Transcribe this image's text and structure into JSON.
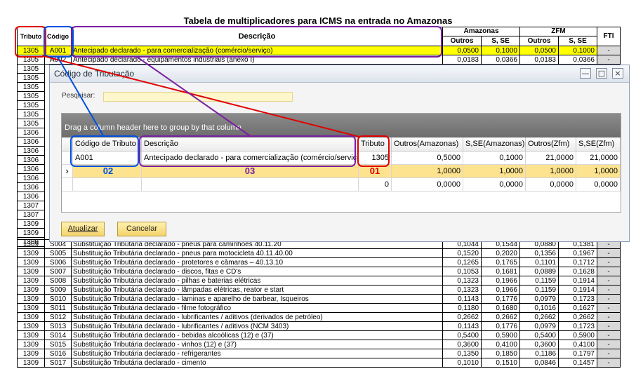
{
  "sheet": {
    "title": "Tabela de multiplicadores para ICMS na entrada no Amazonas",
    "headers": {
      "tributo": "Tributo",
      "codigo": "Código",
      "descricao": "Descrição",
      "amazonas": "Amazonas",
      "zfm": "ZFM",
      "fti": "FTI",
      "outros": "Outros",
      "sse": "S, SE"
    },
    "top_rows": [
      {
        "tributo": "1305",
        "codigo": "A001",
        "desc": "Antecipado declarado - para comercialização (comércio/serviço)",
        "am_outros": "0,0500",
        "am_sse": "0,1000",
        "zfm_outros": "0,0500",
        "zfm_sse": "0,1000",
        "fti": "-",
        "highlight": true
      },
      {
        "tributo": "1305",
        "codigo": "A002",
        "desc": "Antecipado declarado - equipamentos industriais (anexo I)",
        "am_outros": "0,0183",
        "am_sse": "0,0366",
        "zfm_outros": "0,0183",
        "zfm_sse": "0,0366",
        "fti": "-",
        "highlight": false
      }
    ],
    "left_column": [
      "1305",
      "1305",
      "1305",
      "1305",
      "1305",
      "1305",
      "1305",
      "1306",
      "1306",
      "1306",
      "1306",
      "1306",
      "1306",
      "1306",
      "1306",
      "1307",
      "1307",
      "1309",
      "1309",
      "1309"
    ],
    "bottom_rows": [
      {
        "tributo": "1309",
        "codigo": "S004",
        "desc": "Substituição Tributária declarado - pneus para caminhões 40.11.20",
        "am_outros": "0,1044",
        "am_sse": "0,1544",
        "zfm_outros": "0,0880",
        "zfm_sse": "0,1381",
        "fti": "-"
      },
      {
        "tributo": "1309",
        "codigo": "S005",
        "desc": "Substituição Tributária declarado - pneus para motocicleta 40.11.40.00",
        "am_outros": "0,1520",
        "am_sse": "0,2020",
        "zfm_outros": "0,1356",
        "zfm_sse": "0,1967",
        "fti": "-"
      },
      {
        "tributo": "1309",
        "codigo": "S006",
        "desc": "Substituição Tributária declarado - protetores e câmaras – 40.13.10",
        "am_outros": "0,1265",
        "am_sse": "0,1765",
        "zfm_outros": "0,1101",
        "zfm_sse": "0,1712",
        "fti": "-"
      },
      {
        "tributo": "1309",
        "codigo": "S007",
        "desc": "Substituição Tributária declarado - discos, fitas e CD's",
        "am_outros": "0,1053",
        "am_sse": "0,1681",
        "zfm_outros": "0,0889",
        "zfm_sse": "0,1628",
        "fti": "-"
      },
      {
        "tributo": "1309",
        "codigo": "S008",
        "desc": "Substituição Tributária declarado - pilhas e baterias elétricas",
        "am_outros": "0,1323",
        "am_sse": "0,1966",
        "zfm_outros": "0,1159",
        "zfm_sse": "0,1914",
        "fti": "-"
      },
      {
        "tributo": "1309",
        "codigo": "S009",
        "desc": "Substituição Tributária declarado - lâmpadas  elétricas, reator e start",
        "am_outros": "0,1323",
        "am_sse": "0,1966",
        "zfm_outros": "0,1159",
        "zfm_sse": "0,1914",
        "fti": "-"
      },
      {
        "tributo": "1309",
        "codigo": "S010",
        "desc": "Substituição Tributária declarado - laminas e aparelho de barbear, Isqueiros",
        "am_outros": "0,1143",
        "am_sse": "0,1776",
        "zfm_outros": "0,0979",
        "zfm_sse": "0,1723",
        "fti": "-"
      },
      {
        "tributo": "1309",
        "codigo": "S011",
        "desc": "Substituição Tributária declarado - filme fotográfico",
        "am_outros": "0,1180",
        "am_sse": "0,1680",
        "zfm_outros": "0,1016",
        "zfm_sse": "0,1627",
        "fti": "-"
      },
      {
        "tributo": "1309",
        "codigo": "S012",
        "desc": "Substituição Tributária declarado - lubrificantes / aditivos (derivados de petróleo)",
        "am_outros": "0,2662",
        "am_sse": "0,2662",
        "zfm_outros": "0,2662",
        "zfm_sse": "0,2662",
        "fti": "-"
      },
      {
        "tributo": "1309",
        "codigo": "S013",
        "desc": "Substituição Tributária declarado - lubrificantes / aditivos (NCM 3403)",
        "am_outros": "0,1143",
        "am_sse": "0,1776",
        "zfm_outros": "0,0979",
        "zfm_sse": "0,1723",
        "fti": "-"
      },
      {
        "tributo": "1309",
        "codigo": "S014",
        "desc": "Substituição Tributária declarado - bebidas alcoólicas  (12) e  (37)",
        "am_outros": "0,5400",
        "am_sse": "0,5900",
        "zfm_outros": "0,5400",
        "zfm_sse": "0,5900",
        "fti": "-"
      },
      {
        "tributo": "1309",
        "codigo": "S015",
        "desc": "Substituição Tributária declarado - vinhos (12) e  (37)",
        "am_outros": "0,3600",
        "am_sse": "0,4100",
        "zfm_outros": "0,3600",
        "zfm_sse": "0,4100",
        "fti": "-"
      },
      {
        "tributo": "1309",
        "codigo": "S016",
        "desc": "Substituição Tributária declarado - refrigerantes",
        "am_outros": "0,1350",
        "am_sse": "0,1850",
        "zfm_outros": "0,1186",
        "zfm_sse": "0,1797",
        "fti": "-"
      },
      {
        "tributo": "1309",
        "codigo": "S017",
        "desc": "Substituição Tributária declarado - cimento",
        "am_outros": "0,1010",
        "am_sse": "0,1510",
        "zfm_outros": "0,0846",
        "zfm_sse": "0,1457",
        "fti": "-"
      }
    ]
  },
  "dialog": {
    "title": "Código de Tributação",
    "search_label": "Pesquisar:",
    "search_value": "",
    "group_hint": "Drag a column header here to group by that column",
    "columns": [
      "Código de Tributo",
      "Descrição",
      "Tributo",
      "Outros(Amazonas)",
      "S,SE(Amazonas)",
      "Outros(Zfm)",
      "S,SE(Zfm)"
    ],
    "rows": [
      {
        "codigo": "A001",
        "descricao": "Antecipado declarado - para comercialização (comércio/serviço)",
        "tributo": "1305",
        "outros_am": "0,5000",
        "sse_am": "0,1000",
        "outros_zfm": "21,0000",
        "sse_zfm": "21,0000"
      },
      {
        "codigo": "",
        "descricao": "",
        "tributo": "",
        "outros_am": "1,0000",
        "sse_am": "1,0000",
        "outros_zfm": "1,0000",
        "sse_zfm": "1,0000"
      },
      {
        "codigo": "",
        "descricao": "",
        "tributo": "0",
        "outros_am": "0,0000",
        "sse_am": "0,0000",
        "outros_zfm": "0,0000",
        "sse_zfm": "0,0000"
      }
    ],
    "row_indicator": "›",
    "annotations": {
      "a01": "01",
      "a02": "02",
      "a03": "03"
    },
    "btn_update": "Atualizar",
    "btn_cancel": "Cancelar",
    "minimize": "—",
    "maximize": "□",
    "close": "×"
  },
  "colors": {
    "annotation_red": "#e00000",
    "annotation_blue": "#0050e0",
    "annotation_purple": "#7a1fa2",
    "highlight_yellow": "#ffff00",
    "selected_row": "#fde38f"
  }
}
